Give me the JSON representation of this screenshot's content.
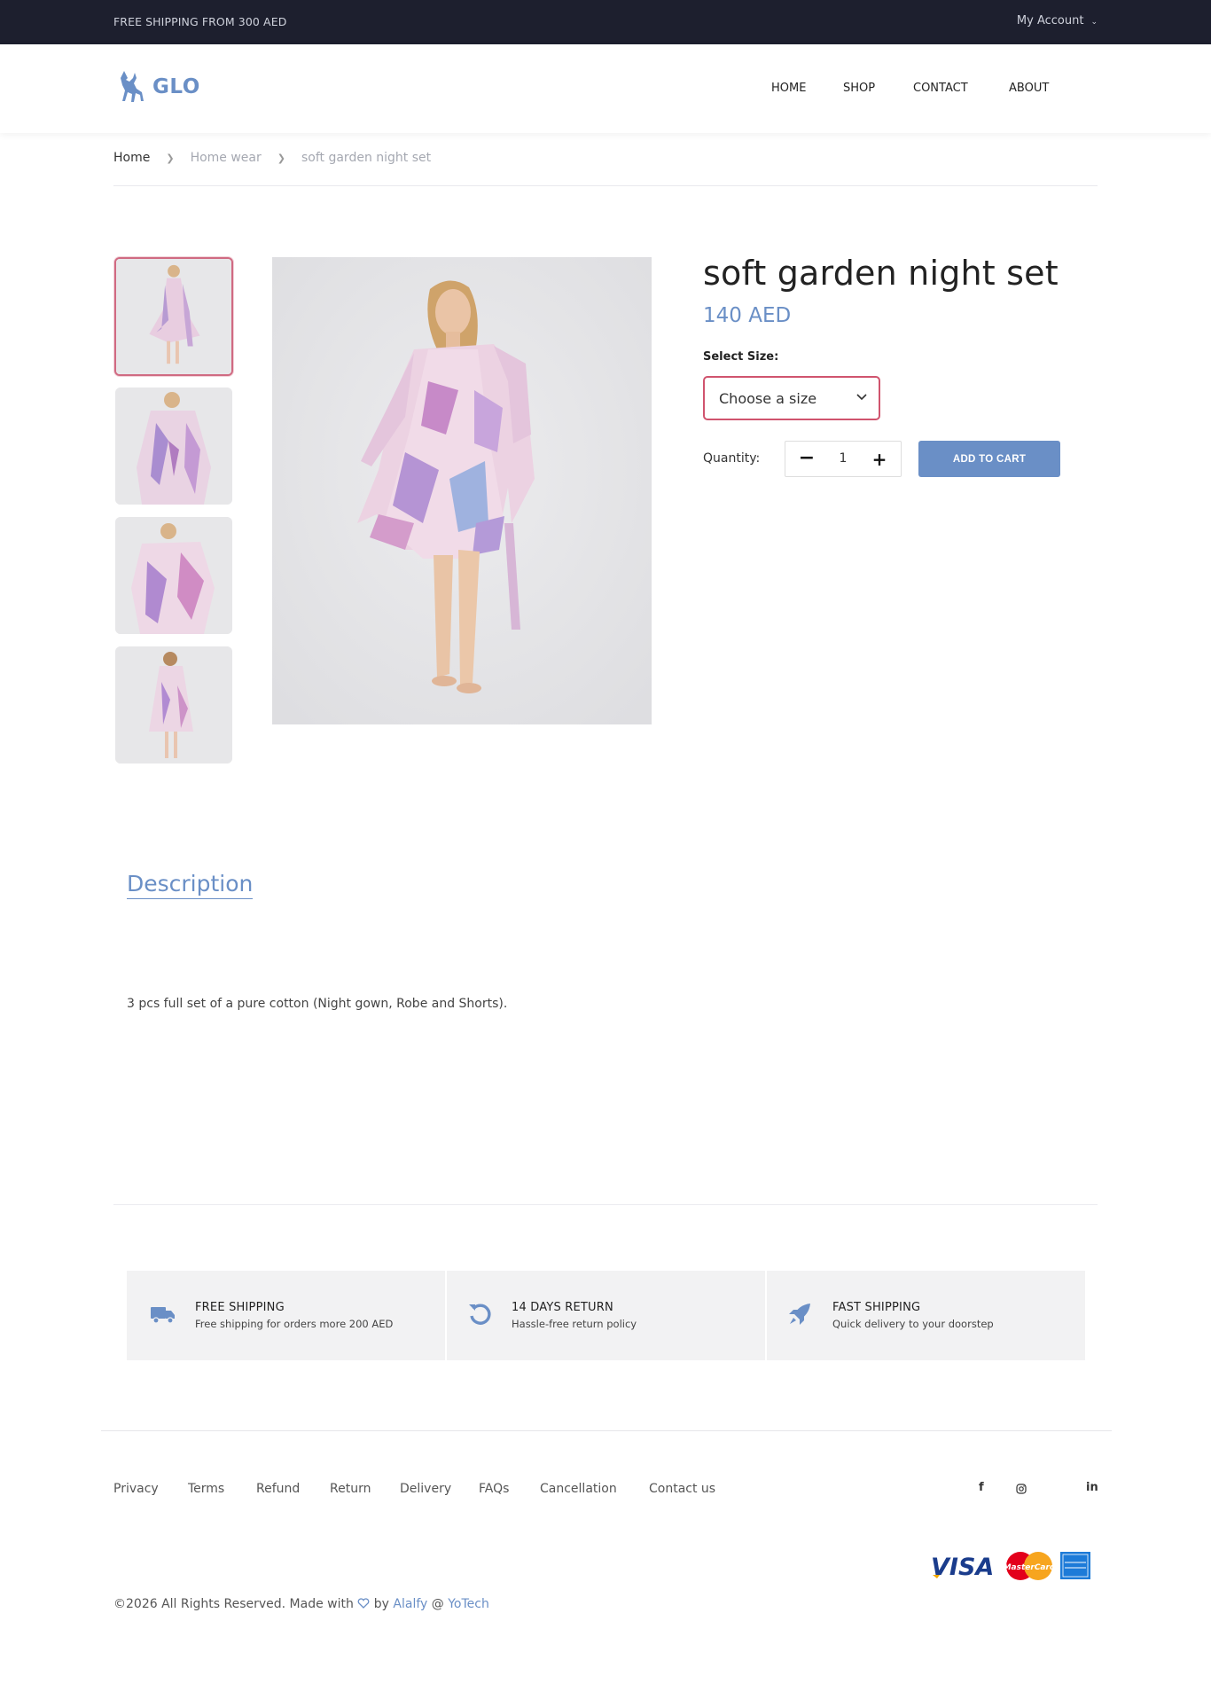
{
  "topbar": {
    "shipping_text": "FREE SHIPPING FROM 300 AED",
    "account_label": "My Account"
  },
  "brand": {
    "name": "GLO",
    "color": "#6a8fc6"
  },
  "nav": [
    "HOME",
    "SHOP",
    "CONTACT",
    "ABOUT"
  ],
  "breadcrumb": [
    "Home",
    "Home wear",
    "soft garden night set"
  ],
  "product": {
    "title": "soft garden night set",
    "price": "140 AED",
    "size_label": "Select Size:",
    "size_placeholder": "Choose a size",
    "quantity_label": "Quantity:",
    "quantity_value": "1",
    "add_to_cart": "ADD TO CART"
  },
  "description": {
    "tab_label": "Description",
    "text": "3 pcs full set of a pure cotton (Night gown, Robe and Shorts)."
  },
  "features": [
    {
      "icon": "truck-icon",
      "title": "FREE SHIPPING",
      "subtitle": "Free shipping for orders more 200 AED"
    },
    {
      "icon": "undo-icon",
      "title": "14 DAYS RETURN",
      "subtitle": "Hassle-free return policy"
    },
    {
      "icon": "rocket-icon",
      "title": "FAST SHIPPING",
      "subtitle": "Quick delivery to your doorstep"
    }
  ],
  "footer": {
    "links": [
      "Privacy",
      "Terms",
      "Refund",
      "Return",
      "Delivery",
      "FAQs",
      "Cancellation",
      "Contact us"
    ],
    "social": [
      "facebook-icon",
      "instagram-icon",
      "linkedin-icon"
    ],
    "payments": [
      "visa-logo",
      "mastercard-logo",
      "amex-logo"
    ],
    "copyright_prefix": "©2026 All Rights Reserved. Made with",
    "copyright_by": "by",
    "author": "Alalfy",
    "at": "@",
    "company": "YoTech"
  },
  "colors": {
    "accent": "#6a8fc6",
    "topbar_bg": "#1d1f2e",
    "select_border": "#d0546e"
  }
}
